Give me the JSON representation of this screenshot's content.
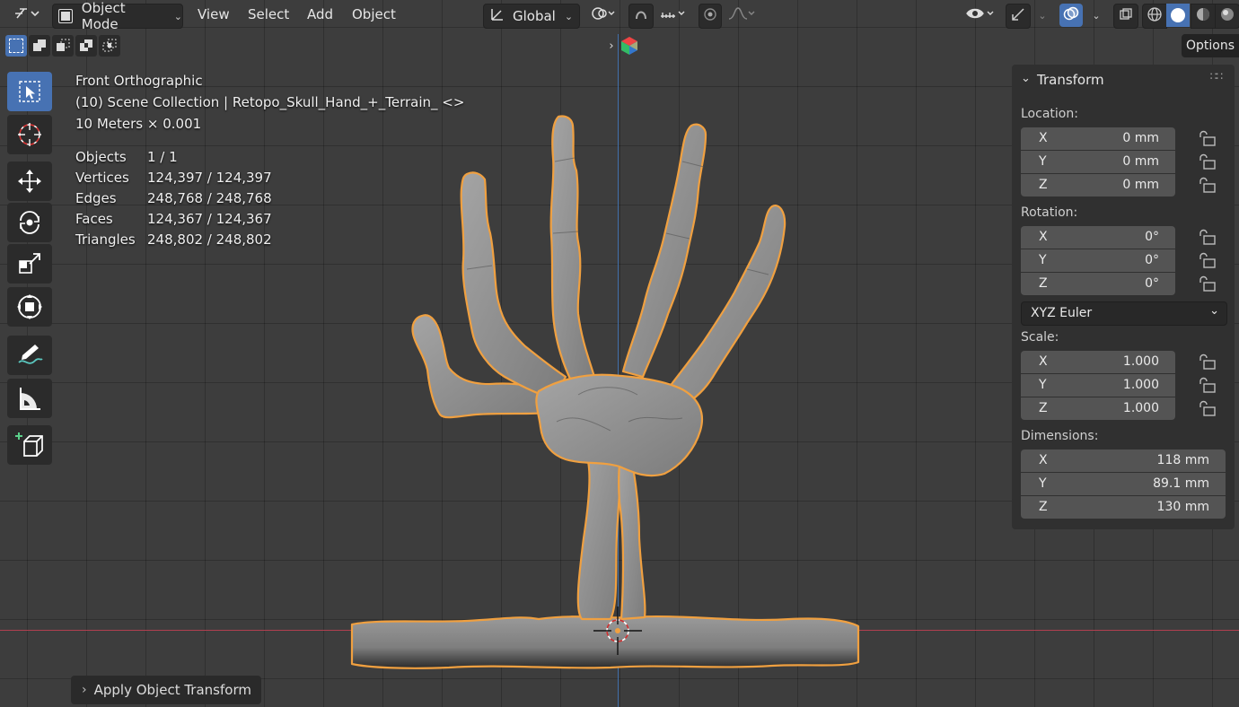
{
  "header": {
    "mode_label": "Object Mode",
    "menus": [
      "View",
      "Select",
      "Add",
      "Object"
    ],
    "orientation_label": "Global"
  },
  "options_label": "Options",
  "viewport": {
    "view_name": "Front Orthographic",
    "collection_line": "(10) Scene Collection | Retopo_Skull_Hand_+_Terrain_ <>",
    "scale_line": "10 Meters × 0.001",
    "stats": [
      {
        "label": "Objects",
        "value": "1 / 1"
      },
      {
        "label": "Vertices",
        "value": "124,397 / 124,397"
      },
      {
        "label": "Edges",
        "value": "248,768 / 248,768"
      },
      {
        "label": "Faces",
        "value": "124,367 / 124,367"
      },
      {
        "label": "Triangles",
        "value": "248,802 / 248,802"
      }
    ]
  },
  "transform_panel": {
    "title": "Transform",
    "location_label": "Location:",
    "location": [
      {
        "axis": "X",
        "value": "0 mm"
      },
      {
        "axis": "Y",
        "value": "0 mm"
      },
      {
        "axis": "Z",
        "value": "0 mm"
      }
    ],
    "rotation_label": "Rotation:",
    "rotation": [
      {
        "axis": "X",
        "value": "0°"
      },
      {
        "axis": "Y",
        "value": "0°"
      },
      {
        "axis": "Z",
        "value": "0°"
      }
    ],
    "rotation_mode": "XYZ Euler",
    "scale_label": "Scale:",
    "scale": [
      {
        "axis": "X",
        "value": "1.000"
      },
      {
        "axis": "Y",
        "value": "1.000"
      },
      {
        "axis": "Z",
        "value": "1.000"
      }
    ],
    "dimensions_label": "Dimensions:",
    "dimensions": [
      {
        "axis": "X",
        "value": "118 mm"
      },
      {
        "axis": "Y",
        "value": "89.1 mm"
      },
      {
        "axis": "Z",
        "value": "130 mm"
      }
    ]
  },
  "last_operator": "Apply Object Transform",
  "colors": {
    "accent": "#4772b3",
    "selection_outline": "#f0a040",
    "x_axis": "#b0404f",
    "z_axis": "#3f6ea8",
    "background": "#3d3d3d"
  },
  "icons": [
    "editor-type-icon",
    "object-mode-icon",
    "transform-orientation-icon",
    "pivot-icon",
    "snap-icon",
    "snap-increment-icon",
    "proportional-edit-icon",
    "falloff-icon",
    "visibility-icon",
    "gizmo-icon",
    "overlay-icon",
    "xray-icon",
    "wireframe-shading-icon",
    "solid-shading-icon",
    "material-shading-icon",
    "rendered-shading-icon",
    "select-box-icon",
    "cursor-icon",
    "move-icon",
    "rotate-icon",
    "scale-icon",
    "transform-icon",
    "annotate-icon",
    "measure-icon",
    "add-cube-icon",
    "lock-icon",
    "expand-arrow-icon",
    "navigation-gizmo-icon"
  ]
}
